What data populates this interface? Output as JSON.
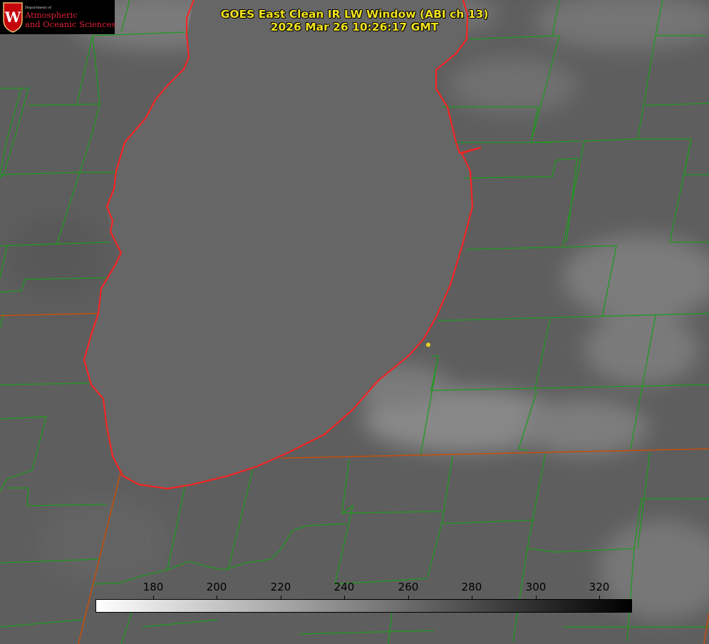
{
  "logo": {
    "dept": "Department of",
    "line1": "Atmospheric",
    "line2": "and Oceanic Sciences",
    "crest_letter": "W"
  },
  "title": {
    "line1": "GOES East Clean IR LW Window (ABI ch 13)",
    "line2": "2026 Mar 26 10:26:17 GMT"
  },
  "colorbar": {
    "ticks": [
      "180",
      "200",
      "220",
      "240",
      "260",
      "280",
      "300",
      "320"
    ]
  },
  "colors": {
    "county_lines": "#1f9a1f",
    "shoreline": "#ff2020",
    "state_lines": "#c05010",
    "title": "#f2e21e",
    "marker": "#e8d020"
  }
}
